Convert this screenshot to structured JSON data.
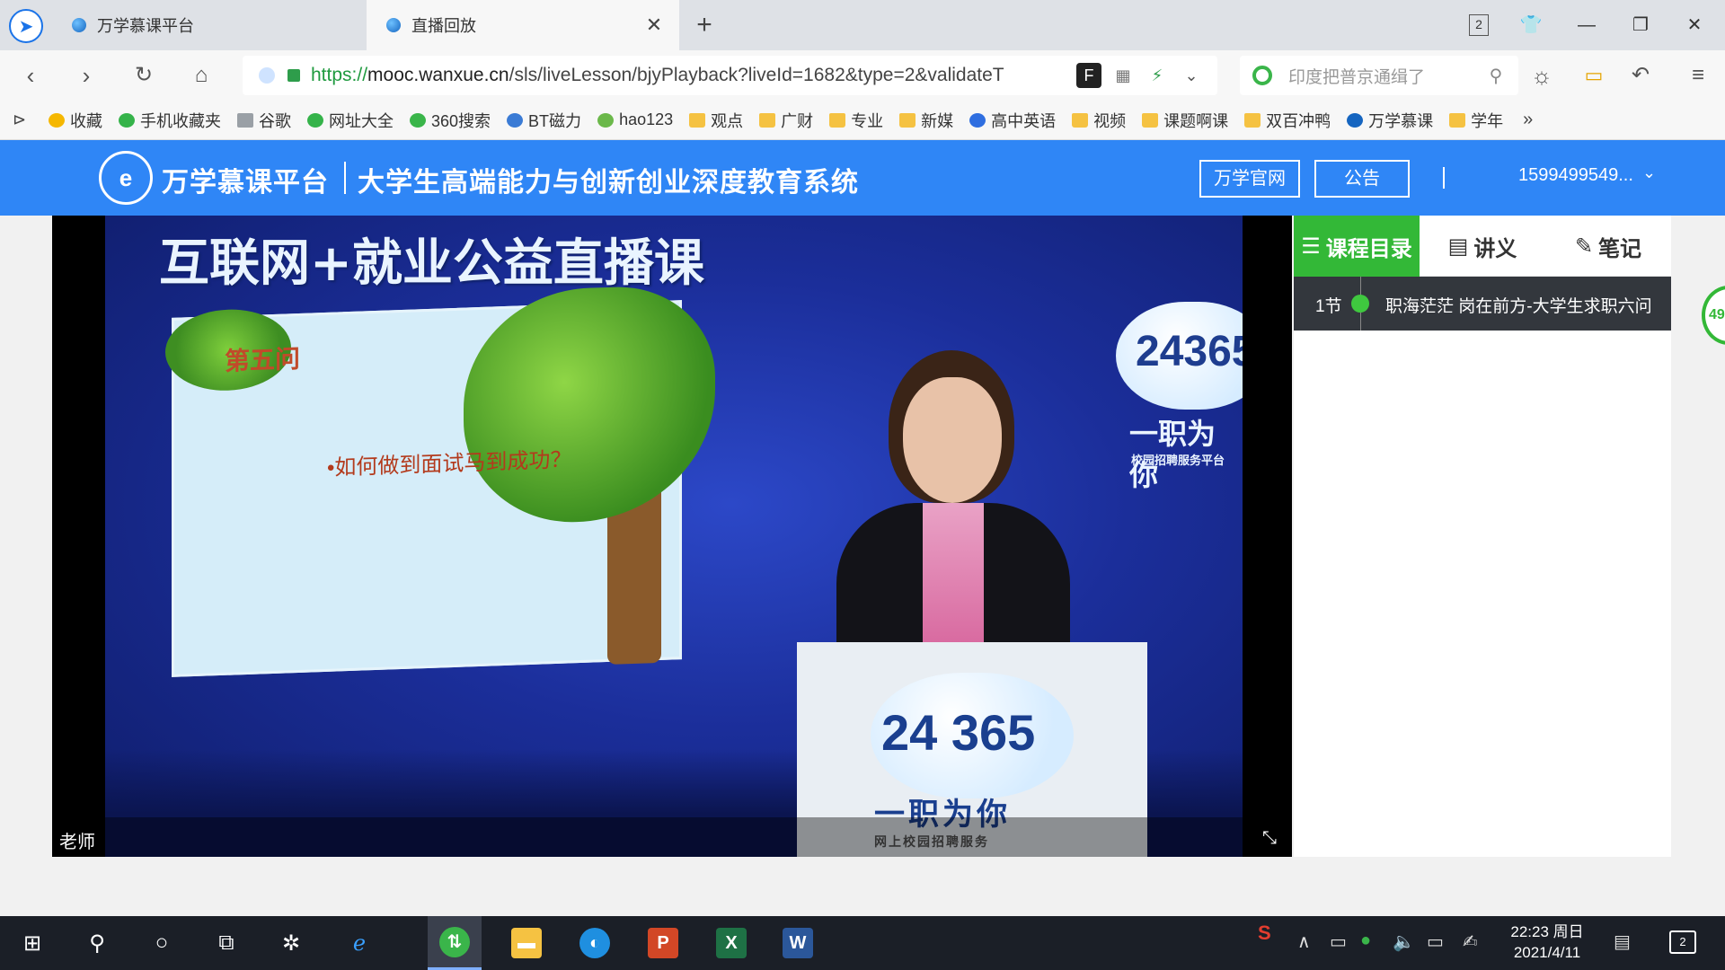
{
  "browser": {
    "tabs": [
      {
        "title": "万学慕课平台",
        "active": false
      },
      {
        "title": "直播回放",
        "active": true
      }
    ],
    "tab_count": "2",
    "url": {
      "scheme": "https://",
      "host": "mooc.wanxue.cn",
      "path": "/sls/liveLesson/bjyPlayback?liveId=1682&type=2&validateT"
    },
    "search_placeholder": "印度把普京通缉了",
    "bookmarks": [
      {
        "label": "收藏",
        "icon": "star-icon"
      },
      {
        "label": "手机收藏夹",
        "icon": "phone-icon"
      },
      {
        "label": "谷歌",
        "icon": "page-icon"
      },
      {
        "label": "网址大全",
        "icon": "web-icon"
      },
      {
        "label": "360搜索",
        "icon": "search-360-icon"
      },
      {
        "label": "BT磁力",
        "icon": "bt-icon"
      },
      {
        "label": "hao123",
        "icon": "hao123-icon"
      },
      {
        "label": "观点",
        "icon": "folder-icon"
      },
      {
        "label": "广财",
        "icon": "folder-icon"
      },
      {
        "label": "专业",
        "icon": "folder-icon"
      },
      {
        "label": "新媒",
        "icon": "folder-icon"
      },
      {
        "label": "高中英语",
        "icon": "paw-icon"
      },
      {
        "label": "视频",
        "icon": "folder-icon"
      },
      {
        "label": "课题啊课",
        "icon": "folder-icon"
      },
      {
        "label": "双百冲鸭",
        "icon": "folder-icon"
      },
      {
        "label": "万学慕课",
        "icon": "wanxue-icon"
      },
      {
        "label": "学年",
        "icon": "folder-icon"
      }
    ],
    "bookmarks_more": "»"
  },
  "site": {
    "logo_glyph": "e",
    "name": "万学慕课平台",
    "slogan": "大学生高端能力与创新创业深度教育系统",
    "official_btn": "万学官网",
    "notice_btn": "公告",
    "user": "1599499549..."
  },
  "video": {
    "banner_title": "互联网+就业公益直播课",
    "slide_heading": "第五问",
    "slide_question": "•如何做到面试马到成功？",
    "logo_number": "24365",
    "logo_slogan": "一职为你",
    "logo_sub": "校园招聘服务平台",
    "podium_number": "24 365",
    "podium_slogan": "一职为你",
    "podium_sub": "网上校园招聘服务",
    "caption": "老师"
  },
  "sidebar": {
    "tabs": [
      {
        "label": "课程目录",
        "icon": "list-icon",
        "active": true
      },
      {
        "label": "讲义",
        "icon": "document-icon",
        "active": false
      },
      {
        "label": "笔记",
        "icon": "edit-icon",
        "active": false
      }
    ],
    "lessons": [
      {
        "index": "1节",
        "title": "职海茫茫 岗在前方-大学生求职六问"
      }
    ],
    "float_badge": "49"
  },
  "taskbar": {
    "clock_time": "22:23 周日",
    "clock_date": "2021/4/11",
    "notification_count": "2"
  }
}
